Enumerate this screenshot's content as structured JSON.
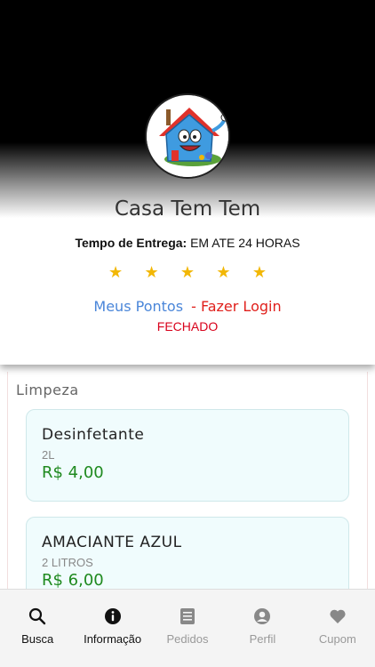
{
  "store": {
    "name": "Casa Tem Tem",
    "delivery_label": "Tempo de Entrega:",
    "delivery_value": "EM ATE 24 HORAS",
    "rating_stars": 5,
    "points_link": "Meus Pontos",
    "login_link": "- Fazer Login",
    "status": "FECHADO"
  },
  "category": {
    "title": "Limpeza"
  },
  "products": [
    {
      "name": "Desinfetante",
      "size": "2L",
      "price": "R$ 4,00"
    },
    {
      "name": "AMACIANTE AZUL",
      "size": "2 LITROS",
      "price": "R$ 6,00"
    }
  ],
  "nav": {
    "items": [
      {
        "label": "Busca",
        "icon": "search-icon",
        "active": true
      },
      {
        "label": "Informação",
        "icon": "info-icon",
        "active": true
      },
      {
        "label": "Pedidos",
        "icon": "list-icon",
        "active": false
      },
      {
        "label": "Perfil",
        "icon": "user-icon",
        "active": false
      },
      {
        "label": "Cupom",
        "icon": "heart-icon",
        "active": false
      }
    ]
  },
  "colors": {
    "star": "#f2b705",
    "points_link": "#4a86d9",
    "login_link": "#e0201c",
    "status_closed": "#d8001a",
    "price": "#1f8a1f",
    "card_background": "#f0fcfd"
  }
}
